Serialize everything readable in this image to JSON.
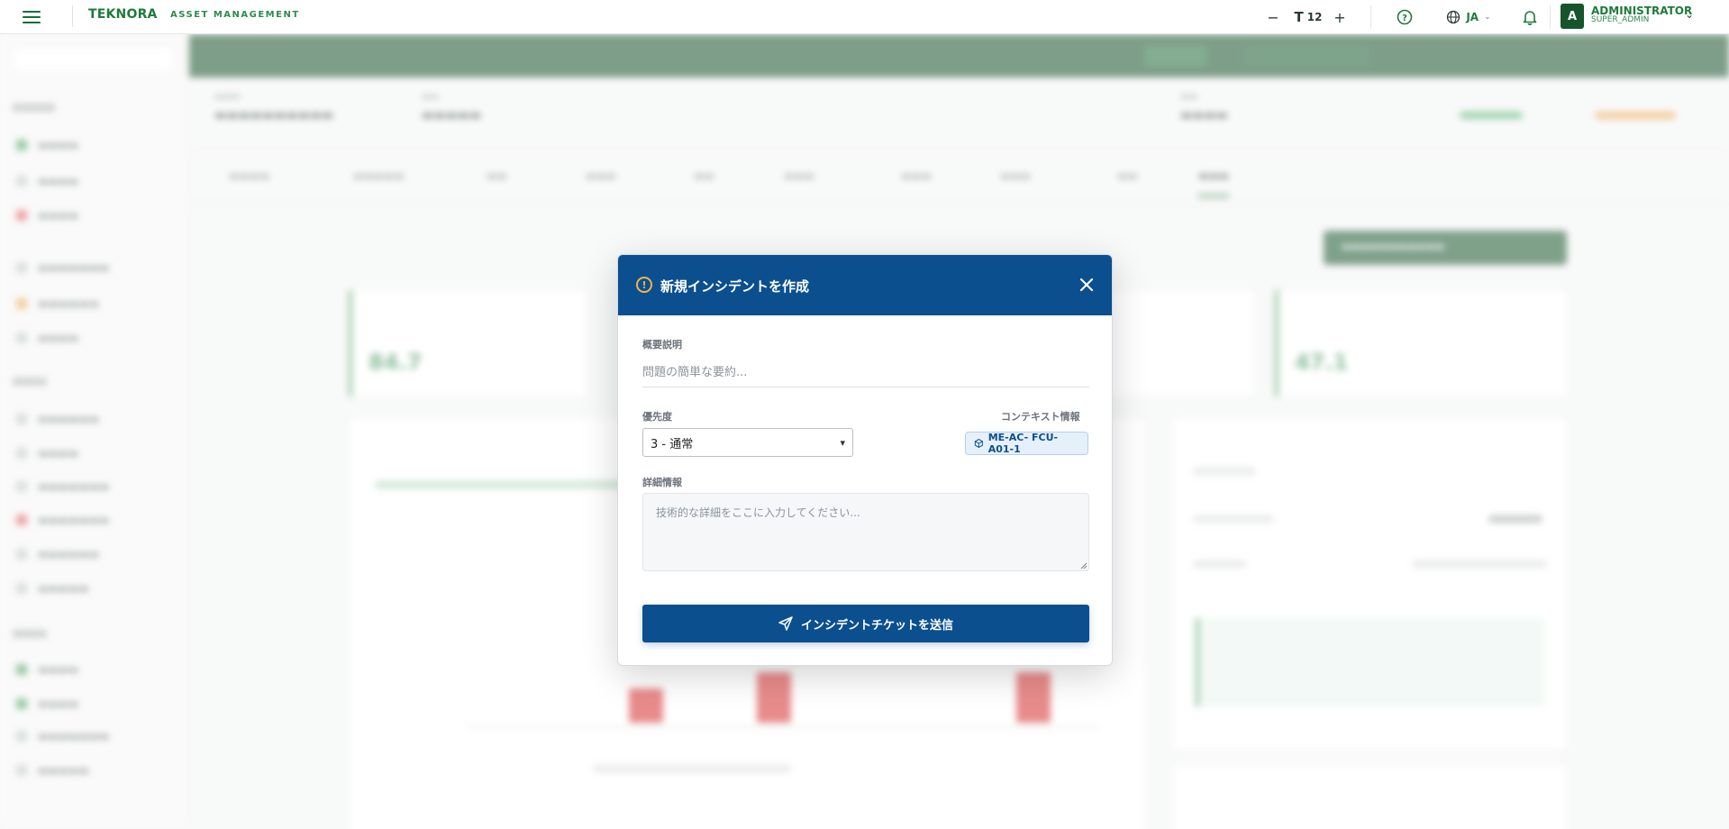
{
  "topbar": {
    "brand": "TEKNORA",
    "brand_sub": "ASSET MANAGEMENT",
    "font_size_value": "12",
    "language": "JA",
    "user_initial": "A",
    "user_name": "ADMINISTRATOR",
    "user_role": "SUPER_ADMIN"
  },
  "background": {
    "kpi_values": [
      "84.7",
      "47.1"
    ]
  },
  "modal": {
    "title": "新規インシデントを作成",
    "summary_label": "概要説明",
    "summary_placeholder": "問題の簡単な要約...",
    "priority_label": "優先度",
    "priority_value": "3 - 通常",
    "context_label": "コンテキスト情報",
    "context_value": "ME-AC- FCU-A01-1",
    "details_label": "詳細情報",
    "details_placeholder": "技術的な詳細をここに入力してください...",
    "submit_label": "インシデントチケットを送信"
  },
  "colors": {
    "modal_header": "#0b4f8f",
    "brand_green": "#1f7a3c",
    "app_header_green": "#144f28",
    "alert_orange": "#f0b44a",
    "bar_red": "#d62c2c"
  },
  "icons": [
    "menu-icon",
    "minus-icon",
    "text-size-icon",
    "plus-icon",
    "help-icon",
    "globe-icon",
    "chevron-down-icon",
    "bell-icon",
    "alert-circle-icon",
    "close-icon",
    "cube-icon",
    "send-icon"
  ]
}
